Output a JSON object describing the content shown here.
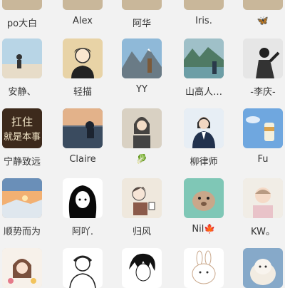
{
  "contacts": [
    {
      "name": "po大白",
      "avatar": "avatar-partial-top"
    },
    {
      "name": "Alex",
      "avatar": "avatar-partial-top"
    },
    {
      "name": "阿华",
      "avatar": "avatar-partial-top"
    },
    {
      "name": "Iris.",
      "avatar": "avatar-partial-top"
    },
    {
      "name": "🦋",
      "avatar": "avatar-partial-top"
    },
    {
      "name": "安静、",
      "avatar": "beach-silhouette"
    },
    {
      "name": "轻描",
      "avatar": "cartoon-boy"
    },
    {
      "name": "YY",
      "avatar": "mountain-landscape"
    },
    {
      "name": "山高人…",
      "avatar": "lake-mountain-person"
    },
    {
      "name": "-李庆-",
      "avatar": "bw-person"
    },
    {
      "name": "宁静致远",
      "avatar": "calligraphy-text"
    },
    {
      "name": "Claire",
      "avatar": "sunset-sea"
    },
    {
      "name": "🥬",
      "avatar": "girl-photo"
    },
    {
      "name": "柳律师",
      "avatar": "woman-suit"
    },
    {
      "name": "Fu",
      "avatar": "blue-sky-drink"
    },
    {
      "name": "顺势而为",
      "avatar": "sunset-ice"
    },
    {
      "name": "阿吖.",
      "avatar": "anime-girl-dark"
    },
    {
      "name": "归风",
      "avatar": "anime-girl-cup"
    },
    {
      "name": "Nil🍁",
      "avatar": "cartoon-mascot"
    },
    {
      "name": "KW。",
      "avatar": "baby-photo"
    },
    {
      "name": "",
      "avatar": "cartoon-girl-flowers"
    },
    {
      "name": "",
      "avatar": "line-drawing-man"
    },
    {
      "name": "",
      "avatar": "anime-bw-boy"
    },
    {
      "name": "",
      "avatar": "white-bunny"
    },
    {
      "name": "",
      "avatar": "alpaca"
    }
  ]
}
